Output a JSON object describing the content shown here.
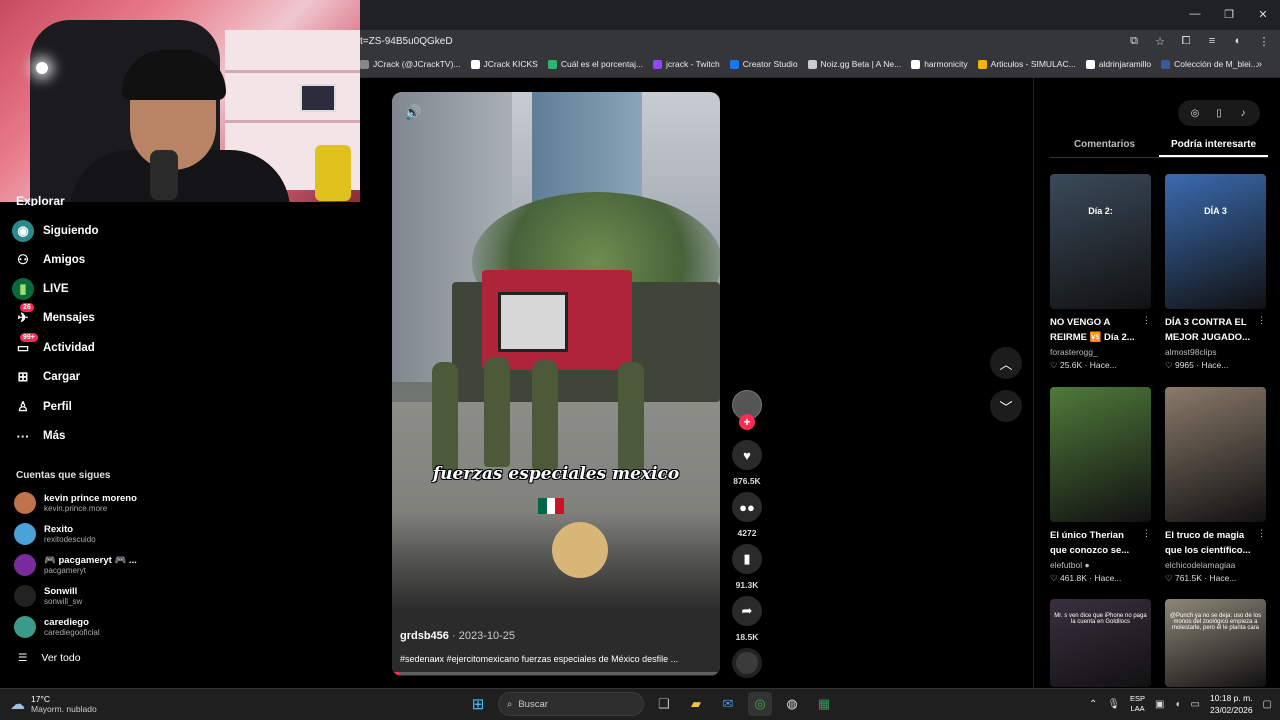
{
  "browser": {
    "url_fragment": "t=ZS-94B5u0QGkeD",
    "bookmarks": [
      {
        "label": "JCrack (@JCrackTV)...",
        "color": "#888888"
      },
      {
        "label": "JCrack KICKS",
        "color": "#ffffff"
      },
      {
        "label": "Cuál es el porcentaj...",
        "color": "#2bb673"
      },
      {
        "label": "jcrack - Twitch",
        "color": "#9146ff"
      },
      {
        "label": "Creator Studio",
        "color": "#1877f2"
      },
      {
        "label": "Noiz.gg Beta | A Ne...",
        "color": "#cccccc"
      },
      {
        "label": "harmonicity",
        "color": "#ffffff"
      },
      {
        "label": "Articulos - SIMULAC...",
        "color": "#f4b400"
      },
      {
        "label": "aldrinjaramillo",
        "color": "#ffffff"
      },
      {
        "label": "Colección de M_blei...",
        "color": "#3b5998"
      }
    ]
  },
  "nav": {
    "partial_top": "Explorar",
    "items": [
      {
        "label": "Siguiendo",
        "icon": "following-avatar-icon",
        "glyph": "◉",
        "badge": ""
      },
      {
        "label": "Amigos",
        "icon": "friends-icon",
        "glyph": "⚇",
        "badge": ""
      },
      {
        "label": "LIVE",
        "icon": "live-icon",
        "glyph": "▮",
        "badge": ""
      },
      {
        "label": "Mensajes",
        "icon": "messages-icon",
        "glyph": "✈",
        "badge": "26"
      },
      {
        "label": "Actividad",
        "icon": "activity-icon",
        "glyph": "▭",
        "badge": "99+"
      },
      {
        "label": "Cargar",
        "icon": "upload-icon",
        "glyph": "⊞",
        "badge": ""
      },
      {
        "label": "Perfil",
        "icon": "profile-icon",
        "glyph": "♙",
        "badge": ""
      },
      {
        "label": "Más",
        "icon": "more-icon",
        "glyph": "···",
        "badge": ""
      }
    ],
    "following_title": "Cuentas que sigues",
    "following": [
      {
        "name": "kevin prince moreno",
        "handle": "kevin.prince.more",
        "color": "#c0724b"
      },
      {
        "name": "Rexito",
        "handle": "rexitodescuido",
        "color": "#4aa3d8"
      },
      {
        "name": "🎮 pacgameryt 🎮 ...",
        "handle": "pacgameryt",
        "color": "#7a2b9b"
      },
      {
        "name": "Sonwill",
        "handle": "sonwill_sw",
        "color": "#222222"
      },
      {
        "name": "carediego",
        "handle": "carediegooficial",
        "color": "#3c9a8a"
      }
    ],
    "see_all": "Ver todo"
  },
  "video": {
    "caption": "fuerzas especiales mexico",
    "author": "grdsb456",
    "date": "2023-10-25",
    "description": "#sedenaиx #ejercitomexicano fuerzas especiales de México desfile ...",
    "progress": 0.02
  },
  "actions": {
    "likes": "876.5K",
    "comments": "4272",
    "saves": "91.3K",
    "shares": "18.5K"
  },
  "panel": {
    "tabs": [
      "Comentarios",
      "Podría interesarte"
    ],
    "active_tab": 1,
    "cards": [
      {
        "title": "NO VENGO A REIRME 🆚 Día 2...",
        "author": "forasterogg_",
        "stats": "♡ 25.6K · Hace...",
        "thumb_text": "Día 2:",
        "bg": "#3a4a5a"
      },
      {
        "title": "DÍA 3 CONTRA EL MEJOR JUGADO...",
        "author": "almost98clips",
        "stats": "♡ 9965 · Hace...",
        "thumb_text": "DÍA 3",
        "bg": "#3a6bb0"
      },
      {
        "title": "El único Therian que conozco se...",
        "author": "elefutbol ●",
        "stats": "♡ 461.8K · Hace...",
        "thumb_text": "",
        "bg": "#4f7a3a"
      },
      {
        "title": "El truco de magia que los científico...",
        "author": "elchicodelamagiaa",
        "stats": "♡ 761.5K · Hace...",
        "thumb_text": "",
        "bg": "#8a7a6a"
      },
      {
        "title": "",
        "author": "",
        "stats": "",
        "thumb_text": "Mr. s ven dice que iPhone no paga la cuenta en Goldilocs",
        "bg": "#3a3040"
      },
      {
        "title": "",
        "author": "",
        "stats": "",
        "thumb_text": "@Punch ya no se deja: uso de los monos del zoológico empieza a molestarle, pero él le planta cara",
        "bg": "#8d8778"
      }
    ]
  },
  "taskbar": {
    "temp": "17°C",
    "condition": "Mayorm. nublado",
    "search_placeholder": "Buscar",
    "lang1": "ESP",
    "lang2": "LAA",
    "time": "10:18 p. m.",
    "date": "23/02/2026"
  },
  "colors": {
    "accent": "#fe2c55",
    "bg": "#000000",
    "chrome": "#35363a"
  }
}
